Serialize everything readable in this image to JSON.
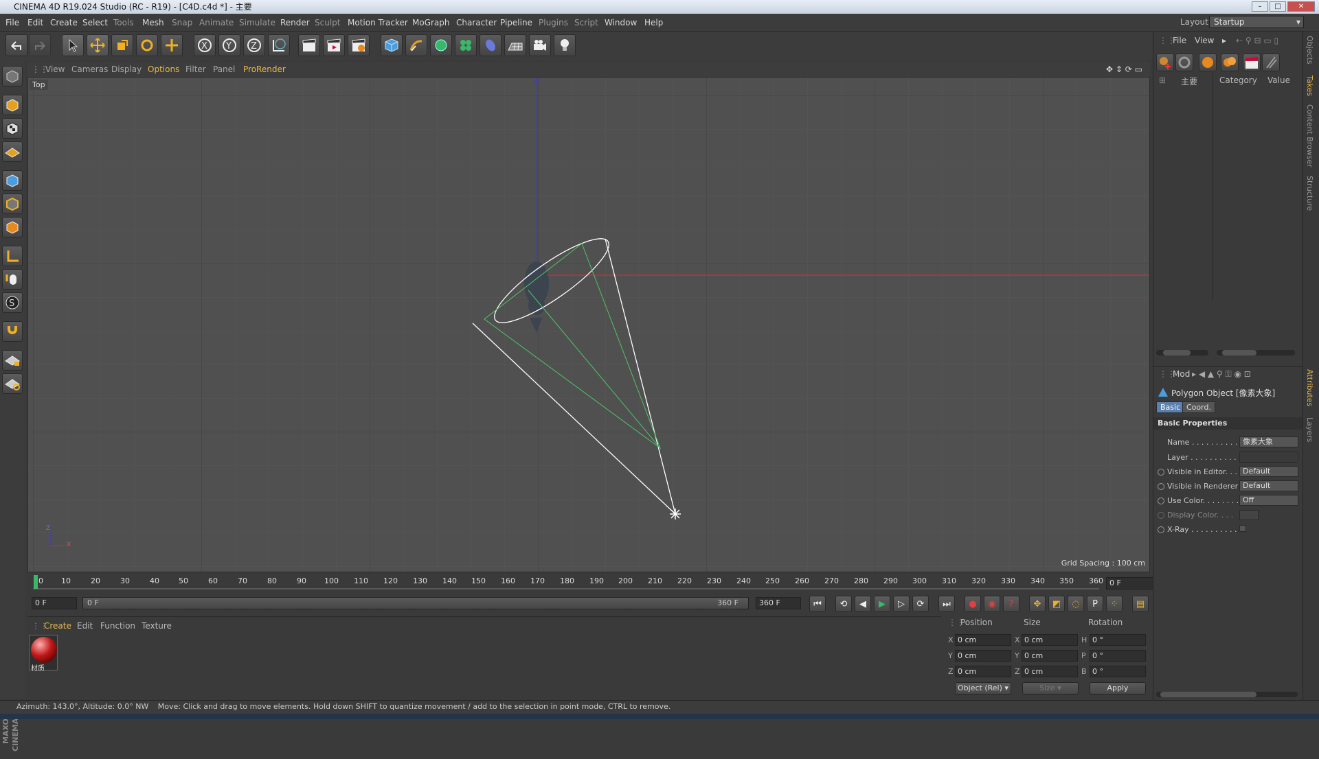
{
  "window": {
    "title": "CINEMA 4D R19.024 Studio (RC - R19) - [C4D.c4d *] - 主要"
  },
  "menu": [
    "File",
    "Edit",
    "Create",
    "Select",
    "Tools",
    "Mesh",
    "Snap",
    "Animate",
    "Simulate",
    "Render",
    "Sculpt",
    "Motion Tracker",
    "MoGraph",
    "Character",
    "Pipeline",
    "Plugins",
    "Script",
    "Window",
    "Help"
  ],
  "layout": {
    "label": "Layout:",
    "value": "Startup"
  },
  "viewport": {
    "menu": [
      "View",
      "Cameras",
      "Display",
      "Options",
      "Filter",
      "Panel",
      "ProRender"
    ],
    "label": "Top",
    "grid_spacing": "Grid Spacing : 100 cm",
    "axis_z": "Z",
    "axis_x": "X"
  },
  "timeline": {
    "ticks": [
      "0",
      "10",
      "20",
      "30",
      "40",
      "50",
      "60",
      "70",
      "80",
      "90",
      "100",
      "110",
      "120",
      "130",
      "140",
      "150",
      "160",
      "170",
      "180",
      "190",
      "200",
      "210",
      "220",
      "230",
      "240",
      "250",
      "260",
      "270",
      "280",
      "290",
      "300",
      "310",
      "320",
      "330",
      "340",
      "350",
      "360"
    ],
    "current_frame": "0 F",
    "start": "0 F",
    "range_start": "0 F",
    "range_end": "360 F",
    "end": "360 F"
  },
  "material_panel": {
    "menu": [
      "Create",
      "Edit",
      "Function",
      "Texture"
    ],
    "material_name": "材质"
  },
  "coords": {
    "headers": [
      "Position",
      "Size",
      "Rotation"
    ],
    "rows": [
      {
        "axis": "X",
        "pos": "0 cm",
        "size_axis": "X",
        "size": "0 cm",
        "rot_axis": "H",
        "rot": "0 °"
      },
      {
        "axis": "Y",
        "pos": "0 cm",
        "size_axis": "Y",
        "size": "0 cm",
        "rot_axis": "P",
        "rot": "0 °"
      },
      {
        "axis": "Z",
        "pos": "0 cm",
        "size_axis": "Z",
        "size": "0 cm",
        "rot_axis": "B",
        "rot": "0 °"
      }
    ],
    "mode": "Object (Rel)",
    "size_mode": "Size",
    "apply": "Apply"
  },
  "objects_panel": {
    "menu": [
      "File",
      "View"
    ],
    "object_name": "主要",
    "col_category": "Category",
    "col_value": "Value"
  },
  "attributes": {
    "mode": "Mod",
    "object_title": "Polygon Object [像素大象]",
    "tabs": [
      "Basic",
      "Coord."
    ],
    "section": "Basic Properties",
    "rows": [
      {
        "label": "Name . . . . . . . . . .",
        "value": "像素大象"
      },
      {
        "label": "Layer . . . . . . . . . .",
        "value": ""
      },
      {
        "label": "Visible in Editor. . .",
        "value": "Default"
      },
      {
        "label": "Visible in Renderer",
        "value": "Default"
      },
      {
        "label": "Use Color. . . . . . . .",
        "value": "Off"
      },
      {
        "label": "Display Color. . . .",
        "value": ""
      },
      {
        "label": "X-Ray . . . . . . . . . .",
        "value": ""
      }
    ]
  },
  "side_tabs": [
    "Objects",
    "Takes",
    "Content Browser",
    "Structure",
    "Attributes",
    "Layers"
  ],
  "status": {
    "left": "Azimuth: 143.0°, Altitude: 0.0°  NW",
    "message": "Move: Click and drag to move elements. Hold down SHIFT to quantize movement / add to the selection in point mode, CTRL to remove."
  },
  "branding": "MAXON CINEMA 4D",
  "colors": {
    "accent": "#e6b94a",
    "x_axis": "#c83232",
    "z_axis": "#3a3ad0",
    "cone": "#ffffff",
    "frustum": "#4fc46a"
  }
}
